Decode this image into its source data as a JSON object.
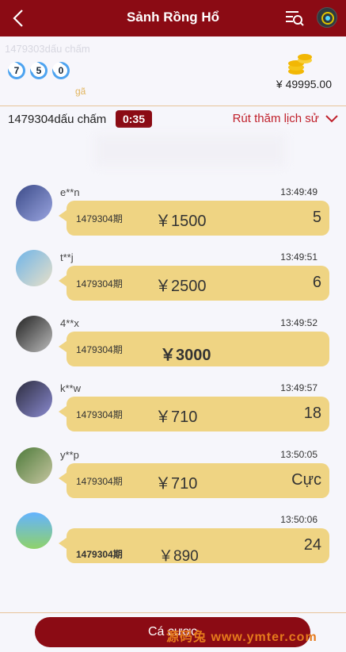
{
  "header": {
    "title": "Sảnh Rồng Hổ"
  },
  "info": {
    "faded_text": "1479303dấu chấm",
    "balls": [
      "7",
      "5",
      "0"
    ],
    "tag": "gã",
    "balance": "¥ 49995.00"
  },
  "period_bar": {
    "period_label": "1479304dấu chấm",
    "countdown": "0:35",
    "history_label": "Rút thăm lịch sử"
  },
  "bets": [
    {
      "user": "e**n",
      "time": "13:49:49",
      "period": "1479304期",
      "amount": "￥1500",
      "choice": "5"
    },
    {
      "user": "t**j",
      "time": "13:49:51",
      "period": "1479304期",
      "amount": "￥2500",
      "choice": "6"
    },
    {
      "user": "4**x",
      "time": "13:49:52",
      "period": "1479304期",
      "amount": "￥3000",
      "choice": ""
    },
    {
      "user": "k**w",
      "time": "13:49:57",
      "period": "1479304期",
      "amount": "￥710",
      "choice": "18"
    },
    {
      "user": "y**p",
      "time": "13:50:05",
      "period": "1479304期",
      "amount": "￥710",
      "choice": "Cực"
    },
    {
      "user": "",
      "time": "13:50:06",
      "period": "1479304期",
      "amount": "￥890",
      "choice": "24"
    }
  ],
  "footer": {
    "bet_button": "Cá cược",
    "watermark": "源码兔 www.ymter.com"
  },
  "colors": {
    "header_bg": "#8b0b14",
    "bubble_bg": "#efd483",
    "history_text": "#c0212c"
  },
  "icons": [
    "back-arrow-icon",
    "list-search-icon",
    "coins-icon",
    "chevron-down-icon"
  ]
}
